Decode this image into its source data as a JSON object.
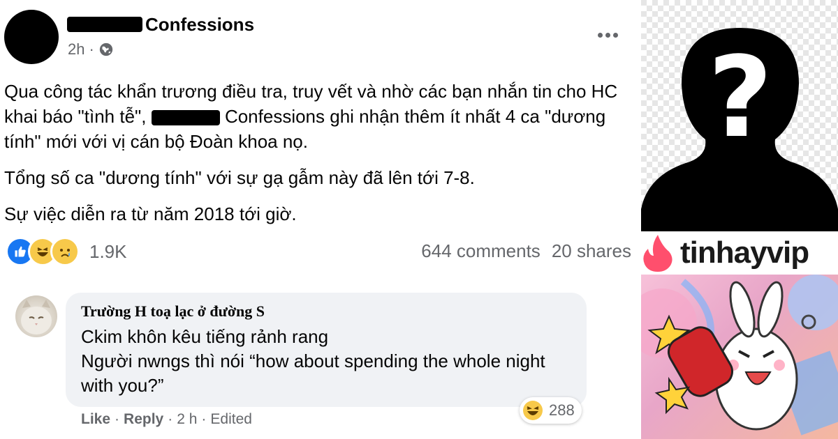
{
  "post": {
    "page_suffix": "Confessions",
    "time": "2h",
    "paragraph1_part1": "Qua công tác khẩn trương điều tra, truy vết và nhờ các bạn nhắn tin cho HC khai báo \"tình tễ\", ",
    "paragraph1_part2": " Confessions ghi nhận thêm ít nhất 4 ca \"dương tính\" mới với vị cán bộ Đoàn khoa nọ.",
    "paragraph2": "Tổng số ca \"dương tính\" với sự gạ gẫm này đã lên tới 7-8.",
    "paragraph3": "Sự việc diễn ra từ năm 2018 tới giờ.",
    "reaction_count": "1.9K",
    "reactions": [
      "like-icon",
      "haha-icon",
      "sad-icon"
    ],
    "comments": "644 comments",
    "shares": "20 shares"
  },
  "comment": {
    "author": "Trường H toạ lạc ở đường S",
    "line1": "Ckim khôn kêu tiếng rảnh rang",
    "line2": "Người nwngs thì nói “how about spending the whole night with you?”",
    "reaction_count": "288",
    "like": "Like",
    "reply": "Reply",
    "time": "2 h",
    "edited": "Edited"
  },
  "brand": {
    "name": "tinhayvip",
    "flame_color": "#ff4f6d"
  },
  "colors": {
    "accent": "#1877f2",
    "secondary_text": "#65676b",
    "bubble": "#f0f2f5"
  }
}
